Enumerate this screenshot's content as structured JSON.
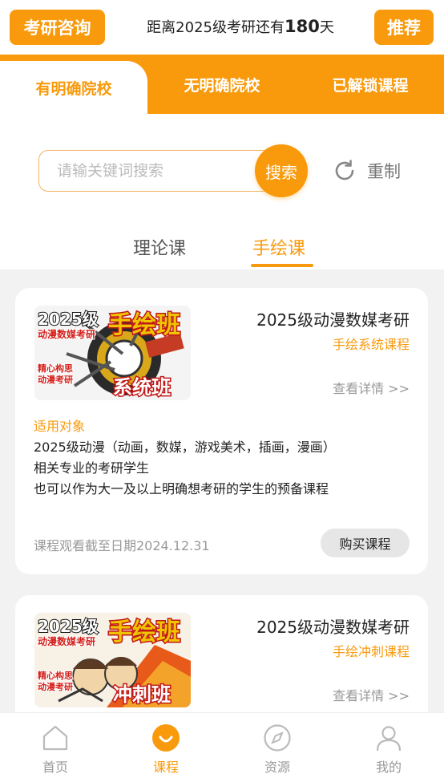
{
  "header": {
    "consult_label": "考研咨询",
    "countdown_prefix": "距离2025级考研还有",
    "countdown_days": "180",
    "countdown_suffix": "天",
    "recommend_label": "推荐"
  },
  "category_tabs": [
    "有明确院校",
    "无明确院校",
    "已解锁课程"
  ],
  "search": {
    "placeholder": "请输关键词搜索",
    "button_label": "搜索",
    "reset_label": "重制"
  },
  "sub_tabs": [
    "理论课",
    "手绘课"
  ],
  "courses": [
    {
      "title": "2025级动漫数媒考研",
      "subtitle": "手绘系统课程",
      "detail_link": "查看详情 >>",
      "thumb": {
        "year": "2025级",
        "big": "手绘班",
        "line": "动漫数媒考研",
        "small1": "精心构思",
        "small2": "动漫考研",
        "badge": "系统班"
      },
      "target_label": "适用对象",
      "desc": [
        "2025级动漫（动画，数媒，游戏美术，插画，漫画）",
        "相关专业的考研学生",
        "也可以作为大一及以上明确想考研的学生的预备课程"
      ],
      "deadline": "课程观看截至日期2024.12.31",
      "buy_label": "购买课程"
    },
    {
      "title": "2025级动漫数媒考研",
      "subtitle": "手绘冲刺课程",
      "detail_link": "查看详情 >>",
      "thumb": {
        "year": "2025级",
        "big": "手绘班",
        "line": "动漫数媒考研",
        "small1": "精心构思",
        "small2": "动漫考研",
        "badge": "冲刺班"
      }
    }
  ],
  "bottom_nav": [
    {
      "label": "首页",
      "icon": "home-icon"
    },
    {
      "label": "课程",
      "icon": "course-smile-icon"
    },
    {
      "label": "资源",
      "icon": "compass-icon"
    },
    {
      "label": "我的",
      "icon": "user-icon"
    }
  ],
  "colors": {
    "accent": "#f89a0c",
    "muted": "#999999"
  }
}
